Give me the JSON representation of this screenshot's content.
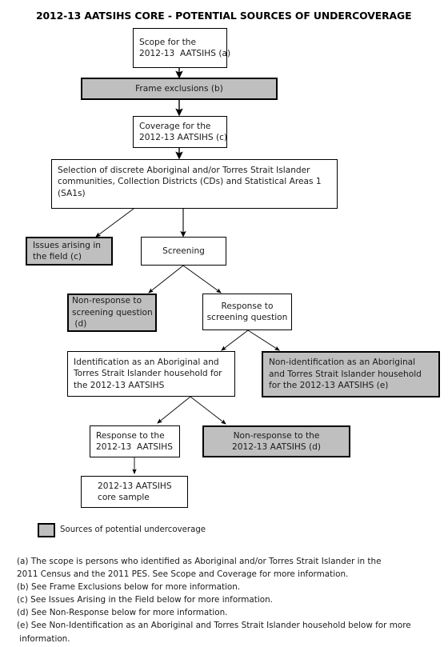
{
  "title": "2012-13 AATSIHS CORE  - POTENTIAL SOURCES OF UNDERCOVERAGE",
  "nodes": {
    "scope": {
      "line1": "Scope for the",
      "line2": "2012-13  AATSIHS (a)"
    },
    "frame_exclusions": {
      "line1": "Frame exclusions (b)"
    },
    "coverage": {
      "line1": "Coverage for the",
      "line2": "2012-13 AATSIHS (c)"
    },
    "selection": {
      "line1": "Selection of discrete Aboriginal and/or Torres Strait Islander",
      "line2": "communities, Collection Districts (CDs) and Statistical Areas 1",
      "line3": "(SA1s)"
    },
    "issues_field": {
      "line1": "Issues arising in",
      "line2": "the field (c)"
    },
    "screening": {
      "line1": "Screening"
    },
    "nonresponse_screening": {
      "line1": "Non-response to",
      "line2": "screening question",
      "line3": " (d)"
    },
    "response_screening": {
      "line1": "Response to",
      "line2": "screening question"
    },
    "identification": {
      "line1": "Identification as an Aboriginal and",
      "line2": "Torres Strait Islander household for",
      "line3": "the 2012-13 AATSIHS"
    },
    "non_identification": {
      "line1": "Non-identification as an Aboriginal",
      "line2": "and Torres Strait Islander household",
      "line3": "for the 2012-13 AATSIHS (e)"
    },
    "response_aatsihs": {
      "line1": "Response to the",
      "line2": "2012-13  AATSIHS"
    },
    "nonresponse_aatsihs": {
      "line1": "Non-response to the",
      "line2": "2012-13 AATSIHS (d)"
    },
    "core_sample": {
      "line1": "2012-13 AATSIHS",
      "line2": "core sample"
    }
  },
  "legend": {
    "label": "Sources of potential undercoverage",
    "swatch_color": "#bfbfbf"
  },
  "footnotes": {
    "a1": "(a) The scope is persons who identified as Aboriginal and/or Torres Strait Islander in the",
    "a2": "2011 Census and the 2011 PES. See Scope and Coverage for more information.",
    "b": "(b) See Frame Exclusions below for more information.",
    "c": "(c) See Issues Arising in the Field below for more information.",
    "d": "(d) See Non-Response below for more information.",
    "e1": "(e) See Non-Identification as an Aboriginal and Torres Strait Islander household below for more",
    "e2": " information."
  }
}
